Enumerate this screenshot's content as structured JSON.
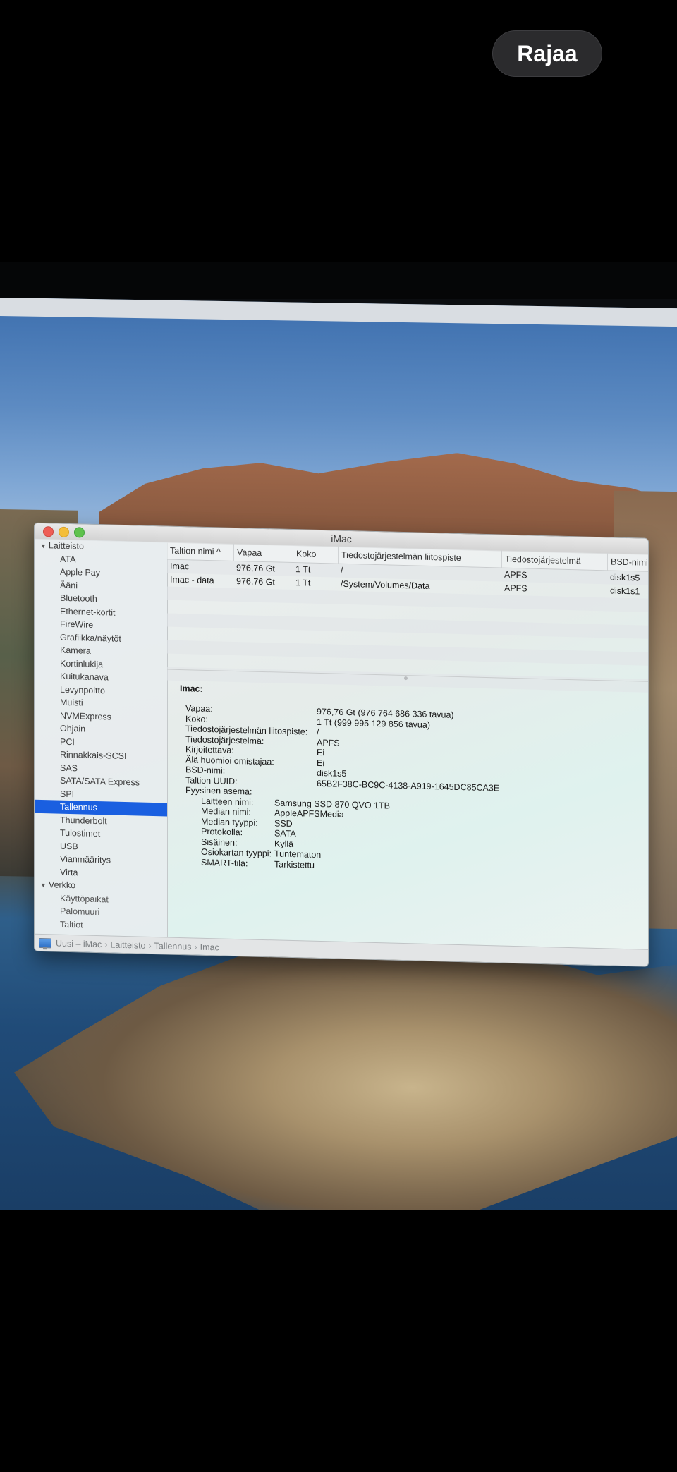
{
  "top_button": "Rajaa",
  "window": {
    "title": "iMac"
  },
  "sidebar": {
    "hardware_label": "Laitteisto",
    "items": [
      "ATA",
      "Apple Pay",
      "Ääni",
      "Bluetooth",
      "Ethernet-kortit",
      "FireWire",
      "Grafiikka/näytöt",
      "Kamera",
      "Kortinlukija",
      "Kuitukanava",
      "Levynpoltto",
      "Muisti",
      "NVMExpress",
      "Ohjain",
      "PCI",
      "Rinnakkais-SCSI",
      "SAS",
      "SATA/SATA Express",
      "SPI",
      "Tallennus",
      "Thunderbolt",
      "Tulostimet",
      "USB",
      "Vianmääritys",
      "Virta"
    ],
    "selected_index": 19,
    "network_label": "Verkko",
    "network_items": [
      "Käyttöpaikat",
      "Palomuuri",
      "Taltiot"
    ]
  },
  "table": {
    "headers": [
      "Taltion nimi",
      "Vapaa",
      "Koko",
      "Tiedostojärjestelmän liitospiste",
      "Tiedostojärjestelmä",
      "BSD-nimi"
    ],
    "sort_indicator": "^",
    "rows": [
      [
        "Imac",
        "976,76 Gt",
        "1 Tt",
        "/",
        "APFS",
        "disk1s5"
      ],
      [
        "Imac - data",
        "976,76 Gt",
        "1 Tt",
        "/System/Volumes/Data",
        "APFS",
        "disk1s1"
      ]
    ]
  },
  "detail": {
    "heading": "Imac:",
    "fields": [
      {
        "label": "Vapaa:",
        "value": "976,76 Gt (976 764 686 336 tavua)"
      },
      {
        "label": "Koko:",
        "value": "1 Tt (999 995 129 856 tavua)"
      },
      {
        "label": "Tiedostojärjestelmän liitospiste:",
        "value": "/"
      },
      {
        "label": "Tiedostojärjestelmä:",
        "value": "APFS"
      },
      {
        "label": "Kirjoitettava:",
        "value": "Ei"
      },
      {
        "label": "Älä huomioi omistajaa:",
        "value": "Ei"
      },
      {
        "label": "BSD-nimi:",
        "value": "disk1s5"
      },
      {
        "label": "Taltion UUID:",
        "value": "65B2F38C-BC9C-4138-A919-1645DC85CA3E"
      },
      {
        "label": "Fyysinen asema:",
        "value": ""
      }
    ],
    "physical": [
      {
        "label": "Laitteen nimi:",
        "value": "Samsung SSD 870 QVO 1TB"
      },
      {
        "label": "Median nimi:",
        "value": "AppleAPFSMedia"
      },
      {
        "label": "Median tyyppi:",
        "value": "SSD"
      },
      {
        "label": "Protokolla:",
        "value": "SATA"
      },
      {
        "label": "Sisäinen:",
        "value": "Kyllä"
      },
      {
        "label": "Osiokartan tyyppi:",
        "value": "Tuntematon"
      },
      {
        "label": "SMART-tila:",
        "value": "Tarkistettu"
      }
    ]
  },
  "breadcrumb": [
    "Uusi – iMac",
    "Laitteisto",
    "Tallennus",
    "Imac"
  ],
  "breadcrumb_separator": "›"
}
